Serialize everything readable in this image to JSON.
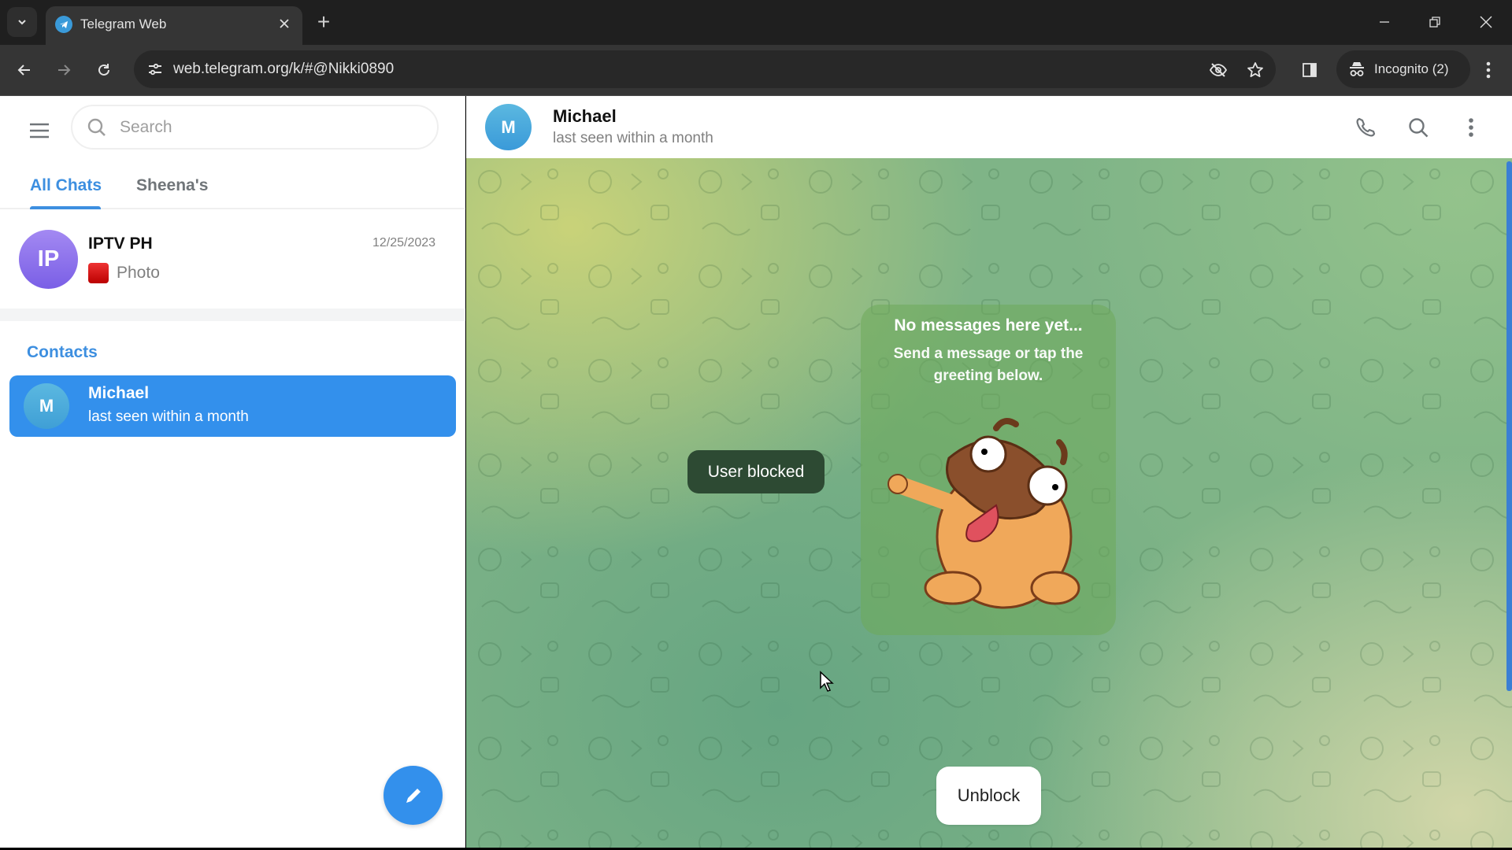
{
  "browser": {
    "tab": {
      "title": "Telegram Web",
      "favicon": "telegram-icon"
    },
    "new_tab_label": "+",
    "url": "web.telegram.org/k/#@Nikki0890",
    "profile_label": "Incognito (2)",
    "icons": [
      "tab-search-icon",
      "back-icon",
      "forward-icon",
      "reload-icon",
      "site-info-icon",
      "eye-off-icon",
      "star-icon",
      "side-panel-icon",
      "incognito-icon",
      "kebab-menu-icon",
      "minimize-icon",
      "restore-icon",
      "close-icon"
    ]
  },
  "sidebar": {
    "search_placeholder": "Search",
    "folders": [
      {
        "label": "All Chats",
        "active": true
      },
      {
        "label": "Sheena's",
        "active": false
      }
    ],
    "chats": [
      {
        "initials": "IP",
        "name": "IPTV PH",
        "date": "12/25/2023",
        "preview": "Photo",
        "avatar_color": "#8c72ec"
      }
    ],
    "contacts_header": "Contacts",
    "contacts": [
      {
        "initials": "M",
        "name": "Michael",
        "status": "last seen within a month",
        "selected": true
      }
    ]
  },
  "chat": {
    "peer": {
      "initials": "M",
      "name": "Michael",
      "status": "last seen within a month"
    },
    "empty_state": {
      "title": "No messages here yet...",
      "subtitle": "Send a message or tap the greeting below."
    },
    "blocked_notice": "User blocked",
    "unblock_label": "Unblock"
  },
  "colors": {
    "accent": "#3390ec",
    "selected_row": "#3390ec",
    "blocked_pill": "#2d4a33"
  }
}
